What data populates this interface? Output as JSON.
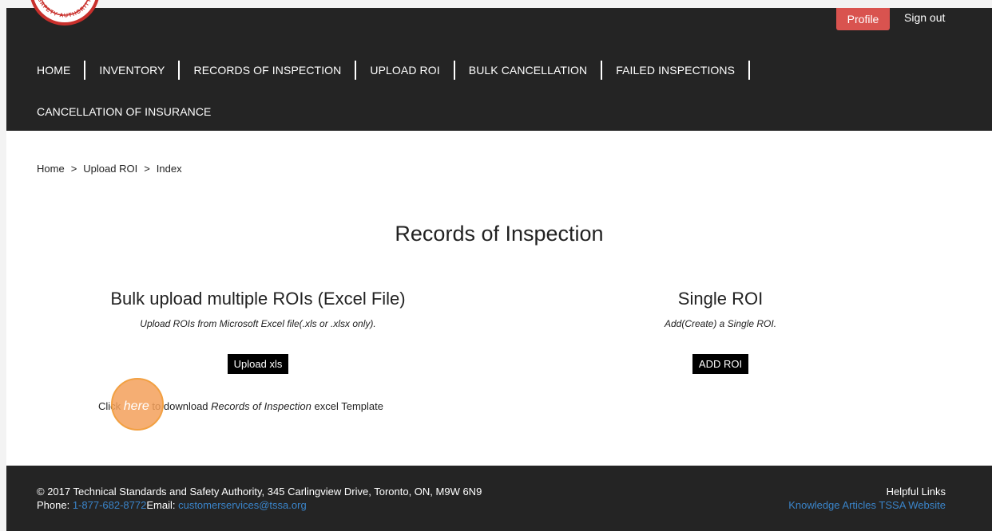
{
  "header": {
    "profile_label": "Profile",
    "signout_label": "Sign out",
    "logo_text": "SAFETY AUTHORITY"
  },
  "nav": {
    "items": [
      "HOME",
      "INVENTORY",
      "RECORDS OF INSPECTION",
      "UPLOAD ROI",
      "BULK CANCELLATION",
      "FAILED INSPECTIONS",
      "CANCELLATION OF INSURANCE"
    ]
  },
  "breadcrumb": {
    "items": [
      "Home",
      "Upload ROI",
      "Index"
    ],
    "separator": ">"
  },
  "main": {
    "title": "Records of Inspection",
    "bulk": {
      "title": "Bulk upload multiple ROIs (Excel File)",
      "description": "Upload ROIs from Microsoft Excel file(.xls or .xlsx only).",
      "button_label": "Upload xls"
    },
    "single": {
      "title": "Single ROI",
      "description": "Add(Create) a Single ROI.",
      "button_label": "ADD ROI"
    },
    "template": {
      "prefix": "Click ",
      "link_text": "here",
      "middle": " to download ",
      "emphasis": "Records of Inspection",
      "suffix": " excel Template"
    }
  },
  "footer": {
    "copyright": "© 2017 Technical Standards and Safety Authority, 345 Carlingview Drive, Toronto, ON, M9W 6N9",
    "phone_label": "Phone: ",
    "phone": "1-877-682-8772",
    "email_label": "Email: ",
    "email": "customerservices@tssa.org",
    "helpful_links_label": "Helpful Links",
    "link_knowledge": "Knowledge Articles",
    "link_website": "TSSA Website"
  },
  "colors": {
    "header_bg": "#242424",
    "profile_bg": "#d9534f",
    "link": "#3a84c9",
    "button_bg": "#000000",
    "click_marker": "#f3a05a"
  }
}
